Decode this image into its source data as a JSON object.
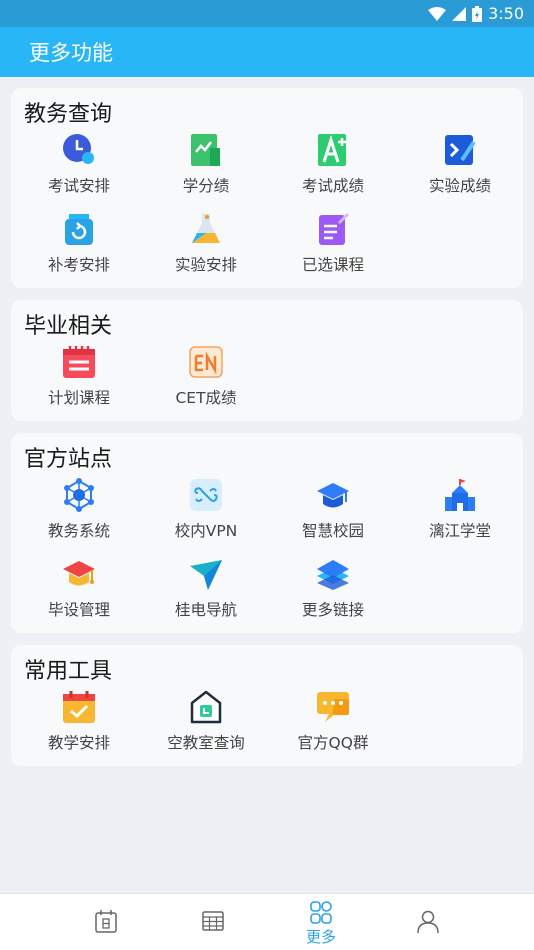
{
  "status_bar": {
    "time": "3:50"
  },
  "app_bar": {
    "title": "更多功能"
  },
  "sections": [
    {
      "title": "教务查询",
      "items": [
        {
          "label": "考试安排",
          "icon": "clock-icon"
        },
        {
          "label": "学分绩",
          "icon": "chart-icon"
        },
        {
          "label": "考试成绩",
          "icon": "grade-a-plus-icon"
        },
        {
          "label": "实验成绩",
          "icon": "lab-result-icon"
        },
        {
          "label": "补考安排",
          "icon": "retake-icon"
        },
        {
          "label": "实验安排",
          "icon": "flask-icon"
        },
        {
          "label": "已选课程",
          "icon": "selected-course-icon"
        }
      ]
    },
    {
      "title": "毕业相关",
      "items": [
        {
          "label": "计划课程",
          "icon": "plan-calendar-icon"
        },
        {
          "label": "CET成绩",
          "icon": "cet-en-icon"
        }
      ]
    },
    {
      "title": "官方站点",
      "items": [
        {
          "label": "教务系统",
          "icon": "network-hub-icon"
        },
        {
          "label": "校内VPN",
          "icon": "vpn-icon"
        },
        {
          "label": "智慧校园",
          "icon": "graduation-cap-icon"
        },
        {
          "label": "漓江学堂",
          "icon": "school-building-icon"
        },
        {
          "label": "毕设管理",
          "icon": "thesis-cap-icon"
        },
        {
          "label": "桂电导航",
          "icon": "navigation-plane-icon"
        },
        {
          "label": "更多链接",
          "icon": "layers-icon"
        }
      ]
    },
    {
      "title": "常用工具",
      "items": [
        {
          "label": "教学安排",
          "icon": "teaching-calendar-icon"
        },
        {
          "label": "空教室查询",
          "icon": "empty-room-icon"
        },
        {
          "label": "官方QQ群",
          "icon": "chat-bubble-icon"
        }
      ]
    }
  ],
  "bottom_nav": {
    "items": [
      {
        "icon": "calendar-day-icon",
        "label": ""
      },
      {
        "icon": "table-grid-icon",
        "label": ""
      },
      {
        "icon": "more-grid-icon",
        "label": "更多",
        "active": true
      },
      {
        "icon": "profile-icon",
        "label": ""
      }
    ]
  },
  "colors": {
    "app_bar": "#29b6f6",
    "status_bar": "#2a9bd4",
    "active_nav": "#29a3e6"
  }
}
